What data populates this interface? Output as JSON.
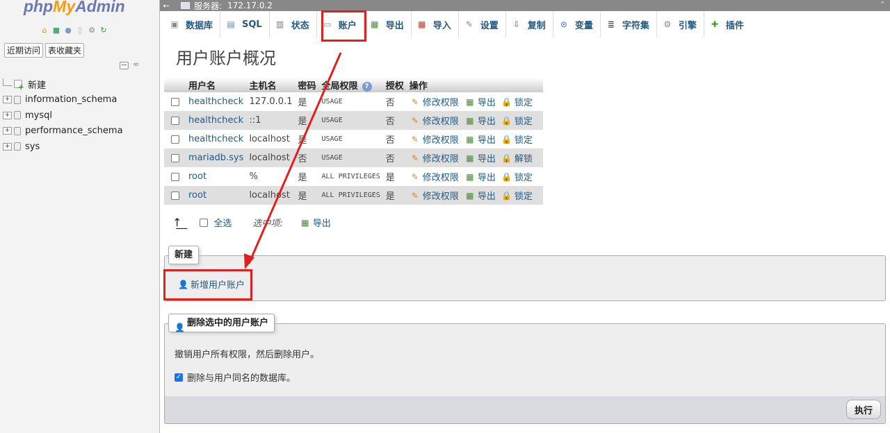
{
  "nav": {
    "logo": {
      "php": "php",
      "my": "My",
      "admin": "Admin"
    },
    "quick_icons": [
      "home-icon",
      "exit-icon",
      "help-icon",
      "docs-icon",
      "settings-icon",
      "reload-icon"
    ],
    "tabs": [
      "近期访问",
      "表收藏夹"
    ],
    "tree": {
      "new_label": "新建",
      "databases": [
        "information_schema",
        "mysql",
        "performance_schema",
        "sys"
      ]
    }
  },
  "topbar": {
    "server_label": "服务器:",
    "server_value": "172.17.0.2"
  },
  "menu": [
    {
      "label": "数据库",
      "icon": "database-icon"
    },
    {
      "label": "SQL",
      "icon": "sql-icon"
    },
    {
      "label": "状态",
      "icon": "status-icon"
    },
    {
      "label": "账户",
      "icon": "accounts-icon"
    },
    {
      "label": "导出",
      "icon": "export-icon"
    },
    {
      "label": "导入",
      "icon": "import-icon"
    },
    {
      "label": "设置",
      "icon": "wrench-icon"
    },
    {
      "label": "复制",
      "icon": "replication-icon"
    },
    {
      "label": "变量",
      "icon": "variables-icon"
    },
    {
      "label": "字符集",
      "icon": "charset-icon"
    },
    {
      "label": "引擎",
      "icon": "engine-icon"
    },
    {
      "label": "插件",
      "icon": "plugin-icon"
    }
  ],
  "page": {
    "title": "用户账户概况"
  },
  "users_table": {
    "headers": [
      "用户名",
      "主机名",
      "密码",
      "全局权限",
      "授权",
      "操作"
    ],
    "actions": {
      "edit": "修改权限",
      "export": "导出"
    },
    "rows": [
      {
        "user": "healthcheck",
        "host": "127.0.0.1",
        "password": "是",
        "privileges": "USAGE",
        "grant": "否",
        "lock": "锁定"
      },
      {
        "user": "healthcheck",
        "host": "::1",
        "password": "是",
        "privileges": "USAGE",
        "grant": "否",
        "lock": "锁定"
      },
      {
        "user": "healthcheck",
        "host": "localhost",
        "password": "是",
        "privileges": "USAGE",
        "grant": "否",
        "lock": "锁定"
      },
      {
        "user": "mariadb.sys",
        "host": "localhost",
        "password": "否",
        "privileges": "USAGE",
        "grant": "否",
        "lock": "解锁"
      },
      {
        "user": "root",
        "host": "%",
        "password": "是",
        "privileges": "ALL PRIVILEGES",
        "grant": "是",
        "lock": "锁定"
      },
      {
        "user": "root",
        "host": "localhost",
        "password": "是",
        "privileges": "ALL PRIVILEGES",
        "grant": "是",
        "lock": "锁定"
      }
    ]
  },
  "with_selected": {
    "select_all": "全选",
    "label": "选中项:",
    "export": "导出"
  },
  "new_section": {
    "legend": "新建",
    "add_user": "新增用户账户"
  },
  "delete_section": {
    "legend": "删除选中的用户账户",
    "description": "撤销用户所有权限，然后删除用户。",
    "drop_db_option": "删除与用户同名的数据库。",
    "drop_db_checked": true,
    "go_button": "执行"
  },
  "colors": {
    "link": "#235a81",
    "annotation": "#e02020",
    "accent_checkbox": "#1a73e8"
  }
}
